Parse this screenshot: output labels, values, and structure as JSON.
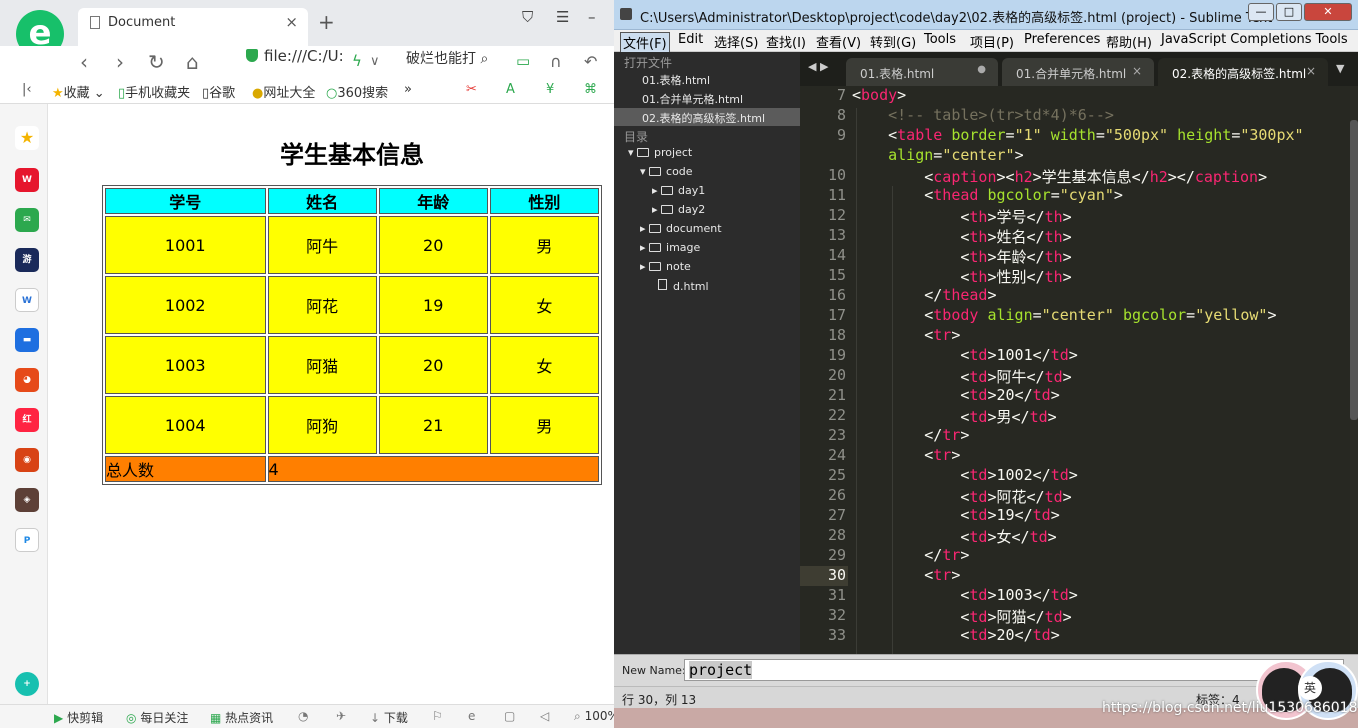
{
  "browser": {
    "tab_title": "Document",
    "tab_close": "×",
    "new_tab": "+",
    "address": "file:///C:/U:",
    "search_text": "破烂也能打",
    "bookmarks": [
      "收藏",
      "手机收藏夹",
      "谷歌",
      "网址大全",
      "360搜索",
      "»"
    ],
    "status_items": [
      "快剪辑",
      "每日关注",
      "热点资讯",
      "下载",
      "100%"
    ],
    "sidebar_icons": [
      "star-icon",
      "weibo-icon",
      "mail-icon",
      "game-icon",
      "doc-icon",
      "chat-icon",
      "bird-icon",
      "xiaohongshu-icon",
      "game2-icon",
      "game3-icon",
      "p-icon",
      "add-icon"
    ]
  },
  "page": {
    "caption": "学生基本信息",
    "headers": [
      "学号",
      "姓名",
      "年龄",
      "性别"
    ],
    "rows": [
      [
        "1001",
        "阿牛",
        "20",
        "男"
      ],
      [
        "1002",
        "阿花",
        "19",
        "女"
      ],
      [
        "1003",
        "阿猫",
        "20",
        "女"
      ],
      [
        "1004",
        "阿狗",
        "21",
        "男"
      ]
    ],
    "footer_label": "总人数",
    "footer_value": "4"
  },
  "editor": {
    "title": "C:\\Users\\Administrator\\Desktop\\project\\code\\day2\\02.表格的高级标签.html (project) - Sublime Text",
    "menu": [
      "文件(F)",
      "Edit",
      "选择(S)",
      "查找(I)",
      "查看(V)",
      "转到(G)",
      "Tools",
      "项目(P)",
      "Preferences",
      "帮助(H)",
      "JavaScript Completions Tools"
    ],
    "sidebar": {
      "open_files_label": "打开文件",
      "open_files": [
        "01.表格.html",
        "01.合并单元格.html",
        "02.表格的高级标签.html"
      ],
      "folders_label": "目录",
      "tree": [
        "project",
        "code",
        "day1",
        "day2",
        "document",
        "image",
        "note",
        "d.html"
      ]
    },
    "tabs": [
      "01.表格.html",
      "01.合并单元格.html",
      "02.表格的高级标签.html"
    ],
    "current_line": "30",
    "input_label": "New Name:",
    "input_value": "project",
    "status_left": "行 30，列 13",
    "status_right": "标签：4",
    "watermark": "https://blog.csdn.net/liu1530686018"
  }
}
